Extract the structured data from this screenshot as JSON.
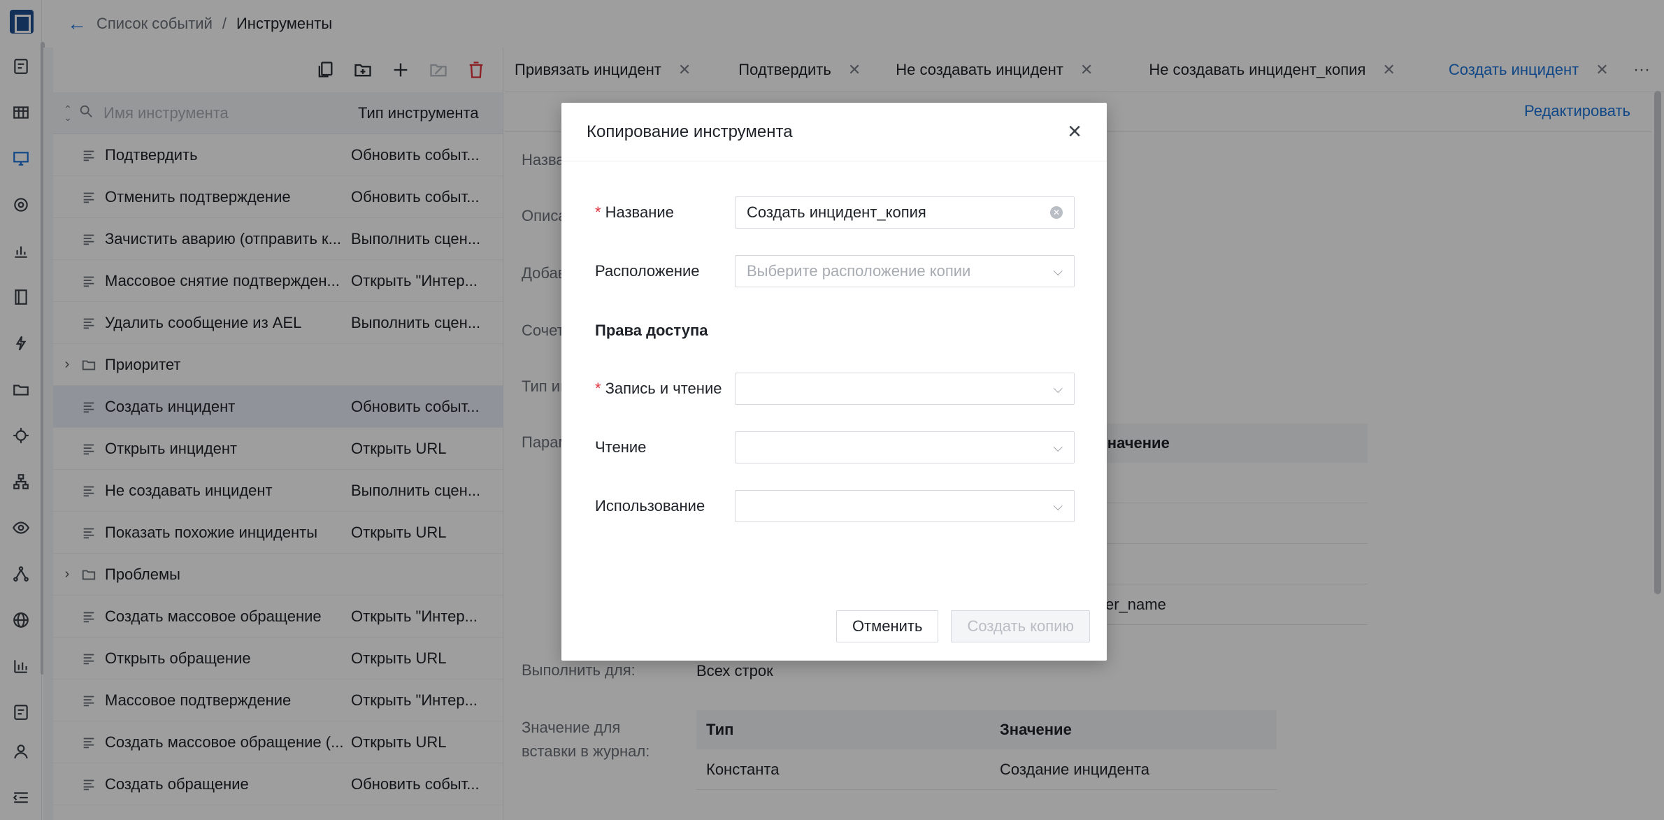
{
  "breadcrumb": {
    "parent": "Список событий",
    "separator": "/",
    "current": "Инструменты"
  },
  "tree": {
    "header": {
      "name_placeholder": "Имя инструмента",
      "type_column": "Тип инструмента"
    },
    "rows": [
      {
        "kind": "item",
        "name": "Подтвердить",
        "type": "Обновить событ..."
      },
      {
        "kind": "item",
        "name": "Отменить подтверждение",
        "type": "Обновить событ..."
      },
      {
        "kind": "item",
        "name": "Зачистить аварию (отправить к...",
        "type": "Выполнить сцен..."
      },
      {
        "kind": "item",
        "name": "Массовое снятие подтвержден...",
        "type": "Открыть \"Интер..."
      },
      {
        "kind": "item",
        "name": "Удалить сообщение из AEL",
        "type": "Выполнить сцен..."
      },
      {
        "kind": "folder",
        "name": "Приоритет",
        "type": ""
      },
      {
        "kind": "item",
        "name": "Создать инцидент",
        "type": "Обновить событ...",
        "selected": true
      },
      {
        "kind": "item",
        "name": "Открыть инцидент",
        "type": "Открыть URL"
      },
      {
        "kind": "item",
        "name": "Не создавать инцидент",
        "type": "Выполнить сцен..."
      },
      {
        "kind": "item",
        "name": "Показать похожие инциденты",
        "type": "Открыть URL"
      },
      {
        "kind": "folder",
        "name": "Проблемы",
        "type": ""
      },
      {
        "kind": "item",
        "name": "Создать массовое обращение",
        "type": "Открыть \"Интер..."
      },
      {
        "kind": "item",
        "name": "Открыть обращение",
        "type": "Открыть URL"
      },
      {
        "kind": "item",
        "name": "Массовое подтверждение",
        "type": "Открыть \"Интер..."
      },
      {
        "kind": "item",
        "name": "Создать массовое обращение (...",
        "type": "Открыть URL"
      },
      {
        "kind": "item",
        "name": "Создать обращение",
        "type": "Обновить событ..."
      }
    ]
  },
  "tabs": [
    {
      "label": "Привязать инцидент"
    },
    {
      "label": "Подтвердить"
    },
    {
      "label": "Не создавать инцидент"
    },
    {
      "label": "Не создавать инцидент_копия"
    },
    {
      "label": "Создать инцидент",
      "active": true
    }
  ],
  "tabs_more": "···",
  "detail": {
    "edit_label": "Редактировать",
    "labels": {
      "name": "Назва",
      "desc": "Описа",
      "added": "Добав",
      "combo": "Сочет",
      "type": "Тип ин",
      "params": "Парам",
      "run_for": "Выполнить для:",
      "journal_1": "Значение для",
      "journal_2": "вставки в журнал:"
    },
    "run_for_value": "Всех строк",
    "params_table": {
      "value_header": "Значение",
      "partial_cell": "ser_name"
    },
    "journal_table": {
      "headers": [
        "Тип",
        "Значение"
      ],
      "row": [
        "Константа",
        "Создание инцидента"
      ]
    }
  },
  "modal": {
    "title": "Копирование инструмента",
    "name_label": "Название",
    "name_value": "Создать инцидент_копия",
    "location_label": "Расположение",
    "location_placeholder": "Выберите расположение копии",
    "access_section": "Права доступа",
    "rw_label": "Запись и чтение",
    "read_label": "Чтение",
    "use_label": "Использование",
    "cancel_label": "Отменить",
    "create_label": "Создать копию",
    "required_mark": "*"
  },
  "colors": {
    "accent": "#1a73d9",
    "danger": "#e0343d",
    "overlay": "rgba(0,0,0,0.38)"
  }
}
